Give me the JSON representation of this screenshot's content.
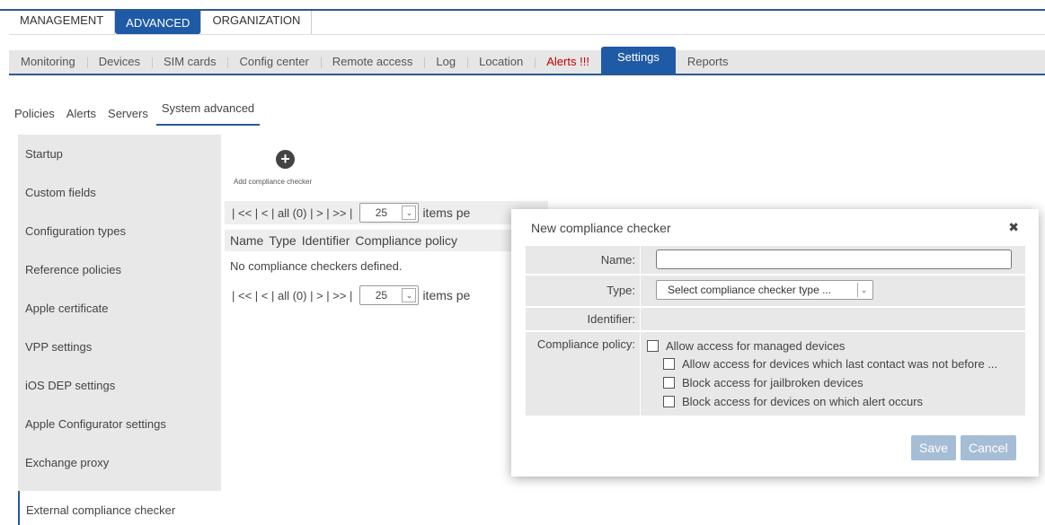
{
  "main_tabs": [
    "MANAGEMENT",
    "ADVANCED",
    "ORGANIZATION"
  ],
  "sub_tabs": [
    "Monitoring",
    "Devices",
    "SIM cards",
    "Config center",
    "Remote access",
    "Log",
    "Location",
    "Alerts !!!",
    "Settings",
    "Reports"
  ],
  "settings_tabs": [
    "Policies",
    "Alerts",
    "Servers",
    "System advanced"
  ],
  "left_nav": [
    "Startup",
    "Custom fields",
    "Configuration types",
    "Reference policies",
    "Apple certificate",
    "VPP settings",
    "iOS DEP settings",
    "Apple Configurator settings",
    "Exchange proxy",
    "External compliance checker"
  ],
  "add_label": "Add compliance checker",
  "pager": {
    "nav_text": "| << | < | all (0) | > | >> |",
    "per_page": "25",
    "items_text": "items pe"
  },
  "table": {
    "columns": [
      "Name",
      "Type",
      "Identifier",
      "Compliance policy"
    ],
    "empty_message": "No compliance checkers defined."
  },
  "modal": {
    "title": "New compliance checker",
    "close_symbol": "✖",
    "name_label": "Name:",
    "name_value": "",
    "type_label": "Type:",
    "type_placeholder": "Select compliance checker type ...",
    "identifier_label": "Identifier:",
    "policy_label": "Compliance policy:",
    "policy_options": [
      "Allow access for managed devices",
      "Allow access for devices which last contact was not before ...",
      "Block access for jailbroken devices",
      "Block access for devices on which alert occurs"
    ],
    "save_label": "Save",
    "cancel_label": "Cancel"
  },
  "colors": {
    "accent": "#1f5aa6",
    "alert": "#c00000",
    "button": "#a6bdd6"
  }
}
